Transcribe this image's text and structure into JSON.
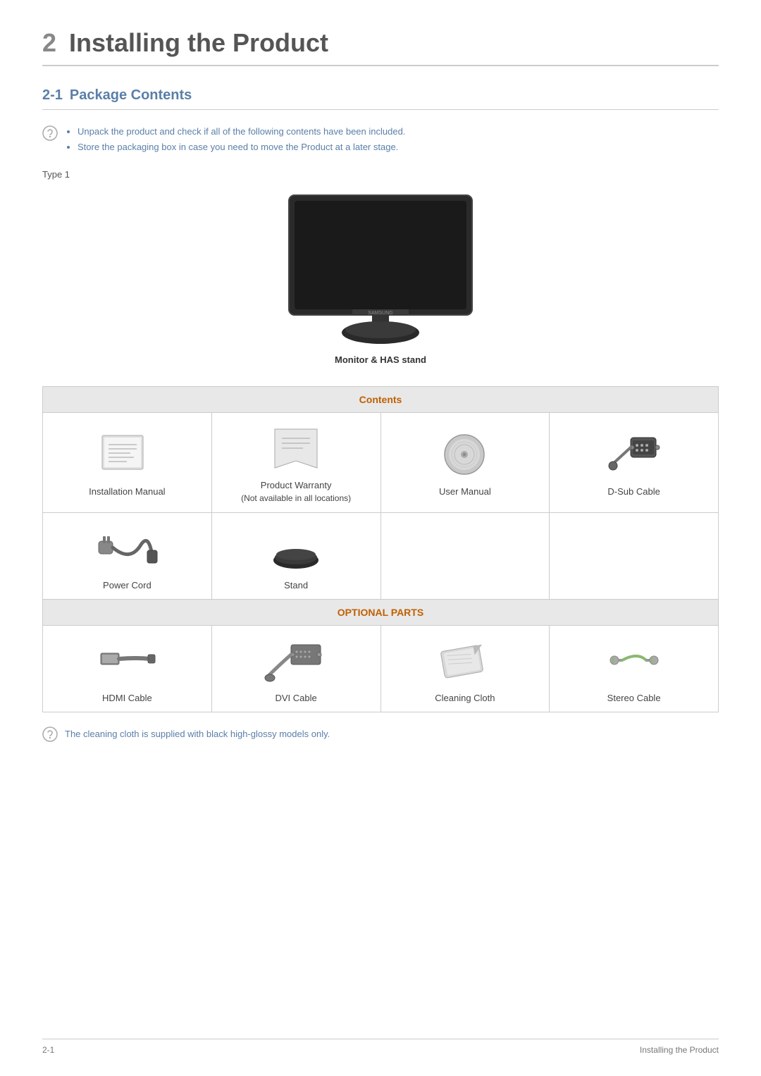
{
  "header": {
    "chapter_num": "2",
    "title": "Installing the Product"
  },
  "section": {
    "num": "2-1",
    "title": "Package Contents"
  },
  "notices": [
    "Unpack the product and check if all of the following contents have been included.",
    "Store the packaging box in case you need to move the Product at a later stage."
  ],
  "type_label": "Type 1",
  "monitor_caption": "Monitor & HAS stand",
  "contents_header": "Contents",
  "optional_header": "OPTIONAL PARTS",
  "contents_items": [
    {
      "label": "Installation Manual"
    },
    {
      "label": "Product Warranty\n(Not available in all locations)"
    },
    {
      "label": "User Manual"
    },
    {
      "label": "D-Sub Cable"
    }
  ],
  "contents_items_row2": [
    {
      "label": "Power Cord"
    },
    {
      "label": "Stand"
    },
    {
      "label": ""
    },
    {
      "label": ""
    }
  ],
  "optional_items": [
    {
      "label": "HDMI Cable"
    },
    {
      "label": "DVI Cable"
    },
    {
      "label": "Cleaning Cloth"
    },
    {
      "label": "Stereo Cable"
    }
  ],
  "footer_notice": "The cleaning cloth is supplied with black high-glossy models only.",
  "footer_left": "2-1",
  "footer_right": "Installing the Product"
}
